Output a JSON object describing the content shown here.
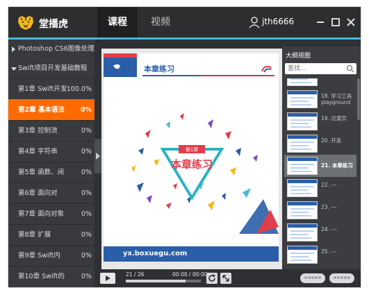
{
  "app": {
    "title": "堂播虎"
  },
  "tabs": [
    {
      "label": "课程"
    },
    {
      "label": "视频"
    }
  ],
  "user": {
    "name": "jth6666"
  },
  "sidebar": {
    "courses": [
      {
        "label": "Photoshop CS6图像处理",
        "expanded": false
      },
      {
        "label": "Swift项目开发基础教程",
        "expanded": true
      }
    ],
    "chapters": [
      {
        "name": "第1章 Swift开发",
        "progress": "100.0%"
      },
      {
        "name": "第2章 基本语法",
        "progress": "0%"
      },
      {
        "name": "第3章 控制流",
        "progress": "0%"
      },
      {
        "name": "第4章 字符串",
        "progress": "0%"
      },
      {
        "name": "第5章 函数、闭",
        "progress": "0%"
      },
      {
        "name": "第6章 面向对",
        "progress": "0%"
      },
      {
        "name": "第7章 面向对象",
        "progress": "0%"
      },
      {
        "name": "第8章 扩展",
        "progress": "0%"
      },
      {
        "name": "第9章 Swift内",
        "progress": "0%"
      },
      {
        "name": "第10章 Swift的",
        "progress": "0%"
      }
    ],
    "active_chapter": 1
  },
  "slide": {
    "title": "本章练习",
    "badge": "第1章",
    "center_title": "本章练习",
    "url": "yx.boxuegu.com"
  },
  "outline": {
    "title": "大纲视图",
    "search_placeholder": "查找...",
    "items": [
      {
        "label": ""
      },
      {
        "label": "18. 学习工具playground"
      },
      {
        "label": "19. 过渡页"
      },
      {
        "label": "20. 开发"
      },
      {
        "label": "21. 本章练习"
      },
      {
        "label": "22. ---"
      },
      {
        "label": "23. ---"
      },
      {
        "label": "24. ---"
      },
      {
        "label": "25. ---"
      }
    ],
    "active_index": 4
  },
  "player": {
    "page": "21 / 26",
    "time": "00:00 / 00:00",
    "progress": 0.8,
    "prev_label": "<<<<<",
    "next_label": ">>>>>"
  },
  "colors": {
    "accent": "#ff6a00",
    "brand_blue": "#2a5ea8",
    "highlight_red": "#e23d4b",
    "topbar_accent": "#46b8d8"
  }
}
